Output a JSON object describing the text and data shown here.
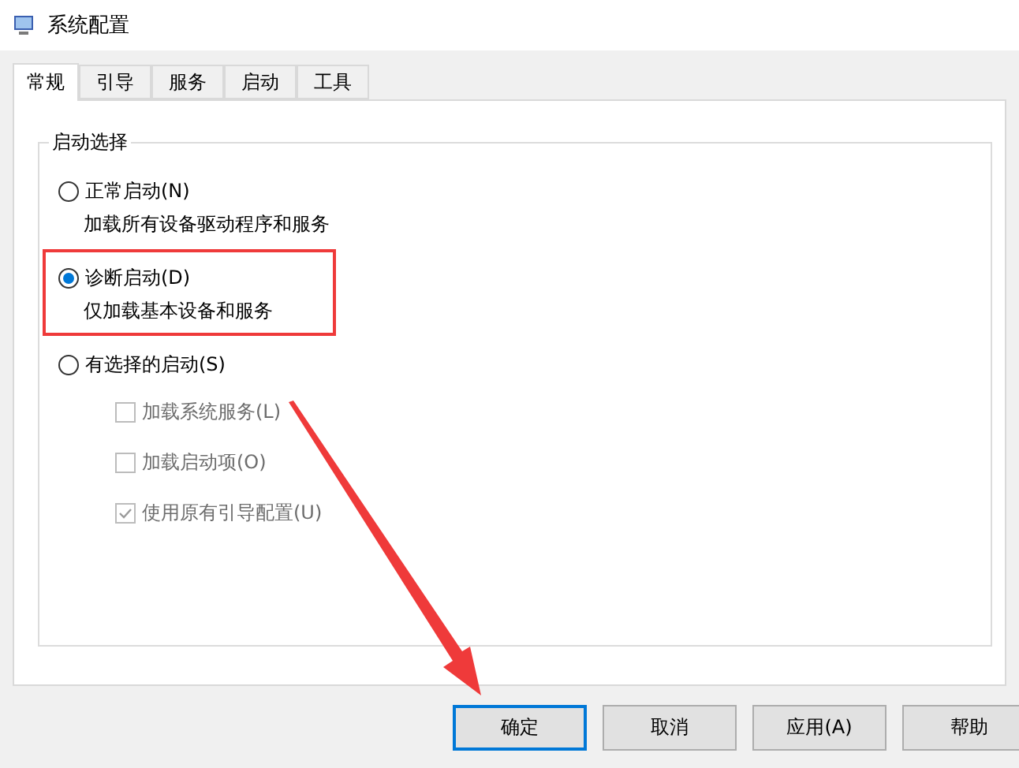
{
  "window": {
    "title": "系统配置"
  },
  "tabs": [
    {
      "label": "常规",
      "selected": true
    },
    {
      "label": "引导",
      "selected": false
    },
    {
      "label": "服务",
      "selected": false
    },
    {
      "label": "启动",
      "selected": false
    },
    {
      "label": "工具",
      "selected": false
    }
  ],
  "startup_selection": {
    "title": "启动选择",
    "options": [
      {
        "label": "正常启动(N)",
        "description": "加载所有设备驱动程序和服务",
        "selected": false,
        "highlighted": false
      },
      {
        "label": "诊断启动(D)",
        "description": "仅加载基本设备和服务",
        "selected": true,
        "highlighted": true
      },
      {
        "label": "有选择的启动(S)",
        "selected": false,
        "highlighted": false,
        "suboptions": [
          {
            "label": "加载系统服务(L)",
            "checked": false,
            "disabled": true
          },
          {
            "label": "加载启动项(O)",
            "checked": false,
            "disabled": true
          },
          {
            "label": "使用原有引导配置(U)",
            "checked": true,
            "disabled": true
          }
        ]
      }
    ]
  },
  "buttons": [
    {
      "label": "确定",
      "default": true
    },
    {
      "label": "取消",
      "default": false
    },
    {
      "label": "应用(A)",
      "default": false
    },
    {
      "label": "帮助",
      "default": false
    }
  ]
}
